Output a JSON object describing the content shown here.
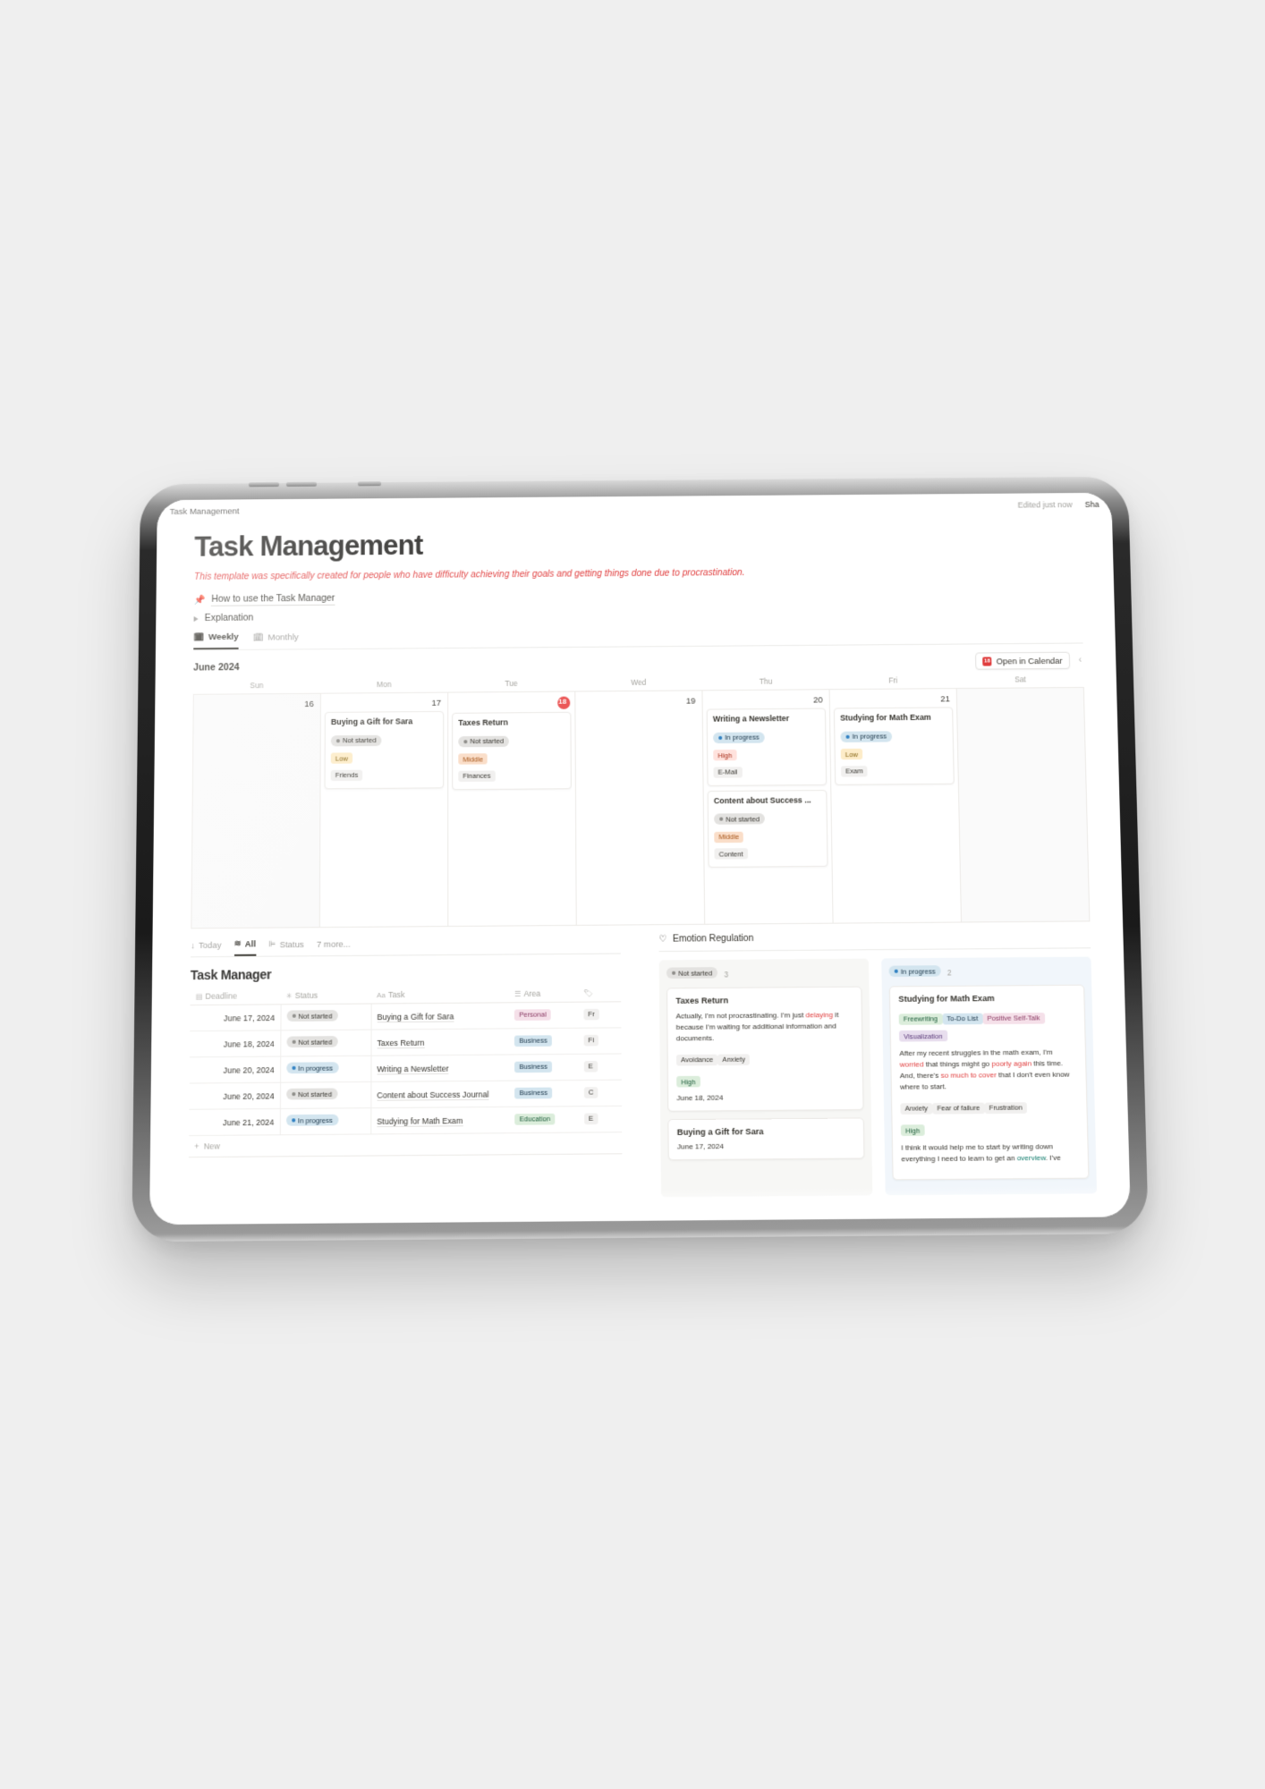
{
  "topbar": {
    "breadcrumb": "Task Management",
    "edited": "Edited just now",
    "share": "Sha"
  },
  "page": {
    "title": "Task Management",
    "subtitle": "This template was specifically created for people who have difficulty achieving their goals and getting things done due to procrastination.",
    "toggles": [
      {
        "icon": "pushpin-icon",
        "glyph": "📌",
        "label": "How to use the Task Manager",
        "underline": true
      },
      {
        "icon": "triangle-right-icon",
        "glyph": "",
        "label": "Explanation",
        "underline": false
      }
    ]
  },
  "view_tabs": [
    {
      "label": "Weekly",
      "icon": "calendar-icon",
      "glyph": "🗓",
      "active": true
    },
    {
      "label": "Monthly",
      "icon": "calendar-icon",
      "glyph": "🗓",
      "active": false
    }
  ],
  "calendar": {
    "month": "June 2024",
    "open_button": "Open in Calendar",
    "open_button_icon_label": "18",
    "prev_glyph": "‹",
    "dow": [
      "Sun",
      "Mon",
      "Tue",
      "Wed",
      "Thu",
      "Fri",
      "Sat"
    ],
    "days": [
      {
        "num": "16",
        "today": false,
        "dim": true,
        "events": []
      },
      {
        "num": "17",
        "today": false,
        "dim": false,
        "events": [
          {
            "title": "Buying a Gift for Sara",
            "status": "Not started",
            "status_type": "notstarted",
            "priority": "Low",
            "priority_type": "low",
            "area": "Friends"
          }
        ]
      },
      {
        "num": "18",
        "today": true,
        "dim": false,
        "events": [
          {
            "title": "Taxes Return",
            "status": "Not started",
            "status_type": "notstarted",
            "priority": "Middle",
            "priority_type": "middle",
            "area": "Finances"
          }
        ]
      },
      {
        "num": "19",
        "today": false,
        "dim": false,
        "events": []
      },
      {
        "num": "20",
        "today": false,
        "dim": false,
        "events": [
          {
            "title": "Writing a Newsletter",
            "status": "In progress",
            "status_type": "inprogress",
            "priority": "High",
            "priority_type": "high",
            "area": "E-Mail"
          },
          {
            "title": "Content about Success ...",
            "status": "Not started",
            "status_type": "notstarted",
            "priority": "Middle",
            "priority_type": "middle",
            "area": "Content"
          }
        ]
      },
      {
        "num": "21",
        "today": false,
        "dim": false,
        "events": [
          {
            "title": "Studying for Math Exam",
            "status": "In progress",
            "status_type": "inprogress",
            "priority": "Low",
            "priority_type": "low",
            "area": "Exam"
          }
        ]
      },
      {
        "num": "",
        "today": false,
        "dim": true,
        "events": []
      }
    ]
  },
  "db_tabs": [
    {
      "label": "Today",
      "icon": "arrow-down-icon",
      "glyph": "↓",
      "active": false
    },
    {
      "label": "All",
      "icon": "list-icon",
      "glyph": "≋",
      "active": true
    },
    {
      "label": "Status",
      "icon": "group-icon",
      "glyph": "⊫",
      "active": false
    },
    {
      "label": "7 more...",
      "icon": "",
      "glyph": "",
      "active": false
    }
  ],
  "task_manager": {
    "heading": "Task Manager",
    "columns": [
      {
        "label": "Deadline",
        "icon": "calendar-icon",
        "glyph": "▤"
      },
      {
        "label": "Status",
        "icon": "status-icon",
        "glyph": "✳"
      },
      {
        "label": "Task",
        "icon": "text-icon",
        "glyph": "Aa"
      },
      {
        "label": "Area",
        "icon": "select-icon",
        "glyph": "☰"
      },
      {
        "label": "",
        "icon": "tag-icon",
        "glyph": "🏷"
      }
    ],
    "rows": [
      {
        "deadline": "June 17, 2024",
        "status": "Not started",
        "status_type": "notstarted",
        "task": "Buying a Gift for Sara",
        "area": "Personal",
        "area_type": "personal",
        "extra": "Fr"
      },
      {
        "deadline": "June 18, 2024",
        "status": "Not started",
        "status_type": "notstarted",
        "task": "Taxes Return",
        "area": "Business",
        "area_type": "business",
        "extra": "Fi"
      },
      {
        "deadline": "June 20, 2024",
        "status": "In progress",
        "status_type": "inprogress",
        "task": "Writing a Newsletter",
        "area": "Business",
        "area_type": "business",
        "extra": "E"
      },
      {
        "deadline": "June 20, 2024",
        "status": "Not started",
        "status_type": "notstarted",
        "task": "Content about Success Journal",
        "area": "Business",
        "area_type": "business",
        "extra": "C"
      },
      {
        "deadline": "June 21, 2024",
        "status": "In progress",
        "status_type": "inprogress",
        "task": "Studying for Math Exam",
        "area": "Education",
        "area_type": "education",
        "extra": "E"
      }
    ],
    "new_label": "New"
  },
  "emotion_regulation": {
    "heading": "Emotion Regulation",
    "heading_icon": "heart-icon",
    "columns": [
      {
        "status": "Not started",
        "status_type": "notstarted",
        "count": "3",
        "cards": [
          {
            "title": "Taxes Return",
            "tags_top": [],
            "body_parts": [
              {
                "t": "Actually, I'm not procrastinating. I'm just ",
                "c": ""
              },
              {
                "t": "delaying",
                "c": "red"
              },
              {
                "t": " it because I'm waiting for additional information and documents.",
                "c": ""
              }
            ],
            "tags": [
              "Avoidance",
              "Anxiety"
            ],
            "level": "High",
            "date": "June 18, 2024"
          },
          {
            "title": "Buying a Gift for Sara",
            "tags_top": [],
            "body_parts": [],
            "tags": [],
            "level": "",
            "date": "June 17, 2024"
          }
        ]
      },
      {
        "status": "In progress",
        "status_type": "inprogress",
        "count": "2",
        "cards": [
          {
            "title": "Studying for Math Exam",
            "tags_top": [
              {
                "label": "Freewriting",
                "type": "green"
              },
              {
                "label": "To-Do List",
                "type": "blue"
              },
              {
                "label": "Positive Self-Talk",
                "type": "pink"
              },
              {
                "label": "Visualization",
                "type": "purple"
              }
            ],
            "body_parts": [
              {
                "t": "After my recent struggles in the math exam, I'm ",
                "c": ""
              },
              {
                "t": "worried",
                "c": "red"
              },
              {
                "t": " that things might go ",
                "c": ""
              },
              {
                "t": "poorly again",
                "c": "red"
              },
              {
                "t": " this time. And, there's ",
                "c": ""
              },
              {
                "t": "so much to cover",
                "c": "red"
              },
              {
                "t": " that I don't even know where to start.",
                "c": ""
              }
            ],
            "tags": [
              "Anxiety",
              "Fear of failure",
              "Frustration"
            ],
            "level": "High",
            "body2_parts": [
              {
                "t": "I think it would help me to start by writing down everything I need to learn to get an ",
                "c": ""
              },
              {
                "t": "overview",
                "c": "grn"
              },
              {
                "t": ". I've",
                "c": ""
              }
            ],
            "date": ""
          }
        ]
      }
    ]
  },
  "colors": {
    "accent_red": "#e03e3e",
    "today_badge": "#eb5757",
    "status_inprogress_bg": "#d3e5ef",
    "status_notstarted_bg": "#e3e2e0",
    "priority_high": "#ffe2dd",
    "priority_middle": "#fadec9",
    "priority_low": "#fdecc8",
    "area_personal": "#f5e0e9",
    "area_business": "#d3e5ef",
    "area_education": "#dbeddb"
  }
}
